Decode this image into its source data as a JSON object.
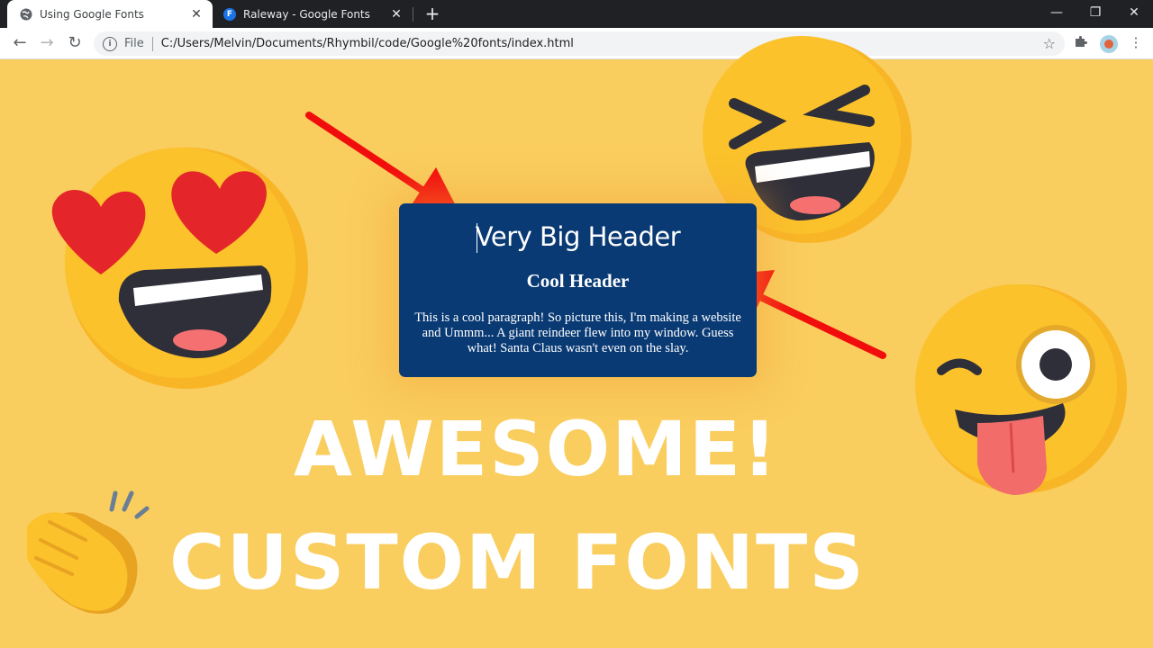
{
  "browser": {
    "tabs": [
      {
        "title": "Using Google Fonts",
        "active": true,
        "favicon": "globe-icon"
      },
      {
        "title": "Raleway - Google Fonts",
        "active": false,
        "favicon": "google-fonts-icon",
        "favicon_letter": "F"
      }
    ],
    "close_glyph": "✕",
    "newtab_glyph": "+",
    "window_controls": {
      "minimize": "—",
      "restore": "❐",
      "close": "✕"
    },
    "nav": {
      "back": "←",
      "forward": "→",
      "reload": "↻"
    },
    "address": {
      "info_glyph": "i",
      "scheme_label": "File",
      "url": "C:/Users/Melvin/Documents/Rhymbil/code/Google%20fonts/index.html",
      "star_glyph": "☆"
    },
    "toolbar_icons": {
      "extensions": "extensions-puzzle-icon",
      "menu_glyph": "⋮"
    }
  },
  "page": {
    "card": {
      "heading_large": "Very Big Header",
      "heading_small": "Cool Header",
      "paragraph": "This is a cool paragraph! So picture this, I'm making a website and Ummm... A giant reindeer flew into my window. Guess what! Santa Claus wasn't even on the slay."
    },
    "overlay": {
      "line1": "AWESOME!",
      "line2": "CUSTOM FONTS"
    }
  },
  "colors": {
    "background": "#f9cd5e",
    "card": "#093a74",
    "arrow": "#f20d0d",
    "emoji_yellow": "#fbc22b",
    "heart": "#e4262a"
  },
  "decor": [
    "heart-eyes-emoji",
    "laughing-emoji",
    "winking-tongue-emoji",
    "clapping-hands-emoji",
    "red-arrow-left",
    "red-arrow-right"
  ]
}
